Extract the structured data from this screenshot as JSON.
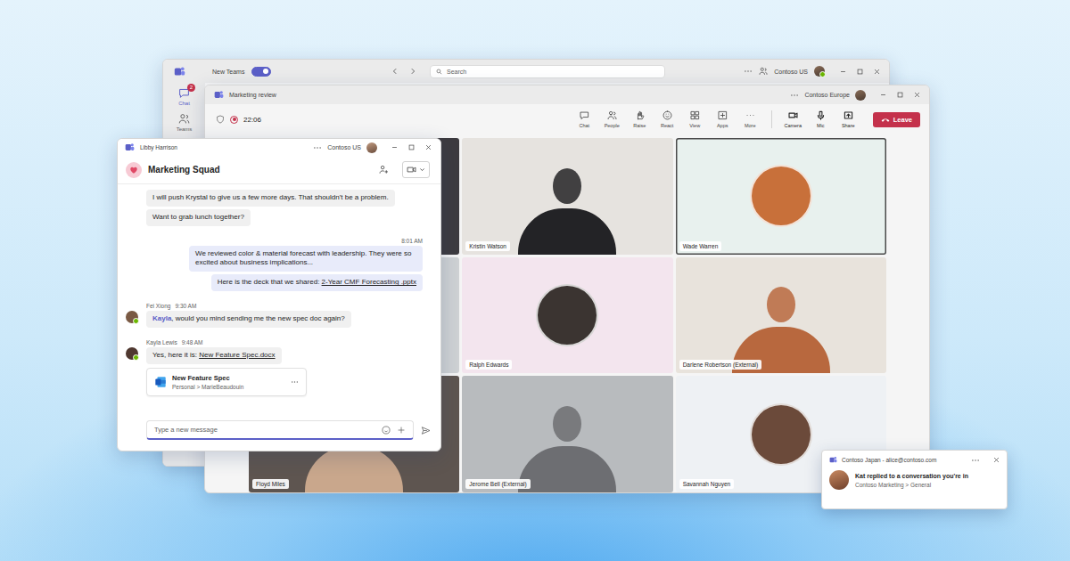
{
  "main_window": {
    "toggle": {
      "label": "New Teams",
      "on": true
    },
    "search": {
      "placeholder": "Search"
    },
    "tenant": "Contoso US",
    "rail": [
      {
        "label": "Chat",
        "badge": "2",
        "selected": true
      },
      {
        "label": "Teams",
        "badge": "",
        "selected": false
      }
    ]
  },
  "meeting_window": {
    "title": "Marketing review",
    "tenant": "Contoso Europe",
    "recording": true,
    "timer": "22:06",
    "toolbar": [
      {
        "label": "Chat"
      },
      {
        "label": "People"
      },
      {
        "label": "Raise"
      },
      {
        "label": "React"
      },
      {
        "label": "View"
      },
      {
        "label": "Apps"
      },
      {
        "label": "More"
      },
      {
        "label": "Camera"
      },
      {
        "label": "Mic"
      },
      {
        "label": "Share"
      }
    ],
    "leave": "Leave",
    "participants": [
      {
        "name": "",
        "kind": "video",
        "color": "#3d3b3f",
        "avatar_color": "#2a2829",
        "speaking": false
      },
      {
        "name": "Kristin Watson",
        "kind": "video",
        "color": "#e6e3df",
        "avatar_color": "#232326",
        "speaking": false
      },
      {
        "name": "Wade Warren",
        "kind": "avatar",
        "color": "#e8f1ee",
        "avatar_color": "#c8703a",
        "speaking": true
      },
      {
        "name": "",
        "kind": "video",
        "color": "#cfd2d4",
        "avatar_color": "#9a9a9c",
        "speaking": false
      },
      {
        "name": "Ralph Edwards",
        "kind": "avatar",
        "color": "#f3e5ee",
        "avatar_color": "#3b3431",
        "speaking": false
      },
      {
        "name": "Darlene Robertson (External)",
        "kind": "video",
        "color": "#e8e3dc",
        "avatar_color": "#b8683e",
        "speaking": false
      },
      {
        "name": "Floyd Miles",
        "kind": "video",
        "color": "#5e5550",
        "avatar_color": "#c9a78c",
        "speaking": false
      },
      {
        "name": "Jerome Bell (External)",
        "kind": "video",
        "color": "#b8bbbe",
        "avatar_color": "#6d6e72",
        "speaking": false
      },
      {
        "name": "Savannah Nguyen",
        "kind": "avatar",
        "color": "#eef1f4",
        "avatar_color": "#6b4a3a",
        "speaking": false
      }
    ]
  },
  "chat_window": {
    "title": "Libby Harrison",
    "tenant": "Contoso US",
    "chat_name": "Marketing Squad",
    "messages": [
      {
        "side": "in",
        "author": "",
        "time": "",
        "avatar": null,
        "parts": [
          {
            "kind": "text",
            "text": "I will push Krystal to give us a few more days. That shouldn't be a problem."
          }
        ],
        "attachment": null
      },
      {
        "side": "in",
        "author": "",
        "time": "",
        "avatar": null,
        "parts": [
          {
            "kind": "text",
            "text": "Want to grab lunch together?"
          }
        ],
        "attachment": null
      },
      {
        "side": "out",
        "author": "",
        "time": "8:01 AM",
        "avatar": null,
        "parts": [
          {
            "kind": "text",
            "text": "We reviewed color & material forecast with leadership. They were so excited about business implications..."
          }
        ],
        "attachment": null
      },
      {
        "side": "out",
        "author": "",
        "time": "",
        "avatar": null,
        "parts": [
          {
            "kind": "text",
            "text": "Here is the deck that we shared: "
          },
          {
            "kind": "link",
            "text": "2-Year CMF Forecasting .pptx"
          }
        ],
        "attachment": null
      },
      {
        "side": "in",
        "author": "Fei Xiong",
        "time": "9:30 AM",
        "avatar": {
          "color": "#7a5a44",
          "online": true
        },
        "parts": [
          {
            "kind": "mention",
            "text": "Kayla"
          },
          {
            "kind": "text",
            "text": ", would you mind sending me the new spec doc again?"
          }
        ],
        "attachment": null
      },
      {
        "side": "in",
        "author": "Kayla Lewis",
        "time": "9:48 AM",
        "avatar": {
          "color": "#4f3830",
          "online": true
        },
        "parts": [
          {
            "kind": "text",
            "text": "Yes, here it is: "
          },
          {
            "kind": "link",
            "text": "New Feature Spec.docx"
          }
        ],
        "attachment": {
          "title": "New Feature Spec",
          "path": "Personal > MarieBeaudouin"
        }
      }
    ],
    "compose": {
      "placeholder": "Type a new message"
    }
  },
  "notification": {
    "account": "Contoso Japan - alice@contoso.com",
    "title": "Kat replied to a conversation you're in",
    "subtitle": "Contoso Marketing > General"
  }
}
